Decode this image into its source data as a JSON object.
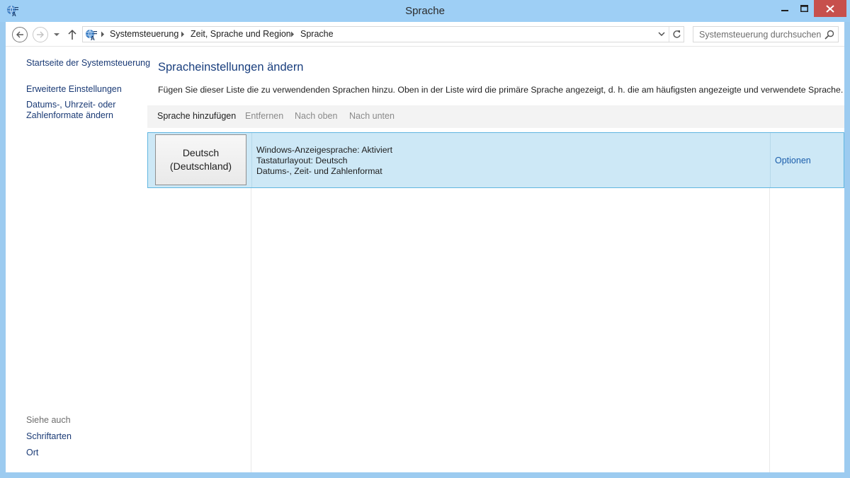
{
  "window": {
    "title": "Sprache",
    "icons": {
      "app": "language-globe-icon",
      "minimize": "minimize-icon",
      "maximize": "maximize-icon",
      "close": "close-icon"
    },
    "colors": {
      "titlebar": "#9ecff5",
      "close_button": "#c7504c"
    }
  },
  "navigation": {
    "icons": {
      "back": "back-arrow-icon",
      "forward": "forward-arrow-icon",
      "recent": "chevron-down-icon",
      "up": "up-arrow-icon",
      "refresh": "refresh-icon"
    },
    "breadcrumbs": [
      "Systemsteuerung",
      "Zeit, Sprache und Region",
      "Sprache"
    ],
    "search_placeholder": "Systemsteuerung durchsuchen"
  },
  "sidebar": {
    "home_link": "Startseite der Systemsteuerung",
    "links": [
      "Erweiterte Einstellungen",
      "Datums-, Uhrzeit- oder",
      "Zahlenformate ändern"
    ],
    "see_also_label": "Siehe auch",
    "see_also_links": [
      "Schriftarten",
      "Ort"
    ]
  },
  "main": {
    "heading": "Spracheinstellungen ändern",
    "description": "Fügen Sie dieser Liste die zu verwendenden Sprachen hinzu. Oben in der Liste wird die primäre Sprache angezeigt, d. h. die am häufigsten angezeigte und verwendete Sprache.",
    "toolbar": {
      "add": "Sprache hinzufügen",
      "remove": "Entfernen",
      "move_up": "Nach oben",
      "move_down": "Nach unten"
    },
    "languages": [
      {
        "name_line1": "Deutsch",
        "name_line2": "(Deutschland)",
        "display_language": "Windows-Anzeigesprache: Aktiviert",
        "keyboard": "Tastaturlayout: Deutsch",
        "format": "Datums-, Zeit- und Zahlenformat",
        "options": "Optionen"
      }
    ],
    "colors": {
      "accent": "#1a3f7e",
      "selected_row": "#cde8f6",
      "link": "#1a5dab"
    }
  }
}
